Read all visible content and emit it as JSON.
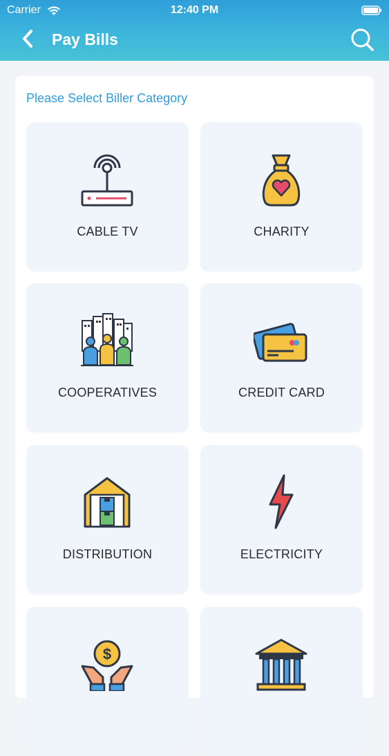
{
  "status_bar": {
    "carrier": "Carrier",
    "time": "12:40 PM"
  },
  "header": {
    "title": "Pay Bills",
    "back_icon": "chevron-left-icon",
    "search_icon": "search-icon"
  },
  "subtitle": "Please Select Biller Category",
  "categories": [
    {
      "label": "CABLE TV",
      "icon": "router-antenna-icon"
    },
    {
      "label": "CHARITY",
      "icon": "charity-bag-icon"
    },
    {
      "label": "COOPERATIVES",
      "icon": "people-city-icon"
    },
    {
      "label": "CREDIT CARD",
      "icon": "credit-card-icon"
    },
    {
      "label": "DISTRIBUTION",
      "icon": "warehouse-icon"
    },
    {
      "label": "ELECTRICITY",
      "icon": "lightning-icon"
    },
    {
      "label": "",
      "icon": "hands-coin-icon"
    },
    {
      "label": "",
      "icon": "bank-icon"
    }
  ],
  "colors": {
    "header_start": "#2e9fd9",
    "header_end": "#46c2d6",
    "accent": "#2f9de0",
    "tile_bg": "#f0f4fb"
  }
}
